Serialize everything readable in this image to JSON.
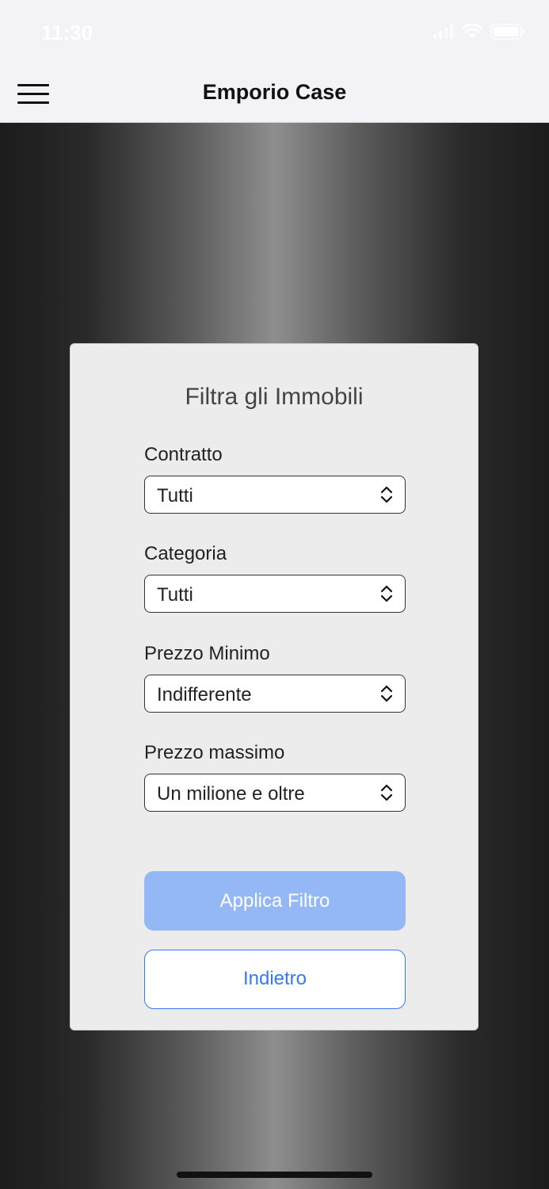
{
  "status_bar": {
    "time": "11:30",
    "icons": [
      "signal-icon",
      "wifi-icon",
      "battery-icon"
    ]
  },
  "nav": {
    "title": "Emporio Case",
    "menu_icon": "hamburger-menu-icon"
  },
  "filter": {
    "title": "Filtra gli Immobili",
    "fields": [
      {
        "label": "Contratto",
        "value": "Tutti"
      },
      {
        "label": "Categoria",
        "value": "Tutti"
      },
      {
        "label": "Prezzo Minimo",
        "value": "Indifferente"
      },
      {
        "label": "Prezzo massimo",
        "value": "Un milione e oltre"
      }
    ],
    "apply_label": "Applica Filtro",
    "back_label": "Indietro"
  },
  "colors": {
    "primary_button": "#94b7f5",
    "accent": "#3478f6",
    "card_background": "#ececec"
  }
}
